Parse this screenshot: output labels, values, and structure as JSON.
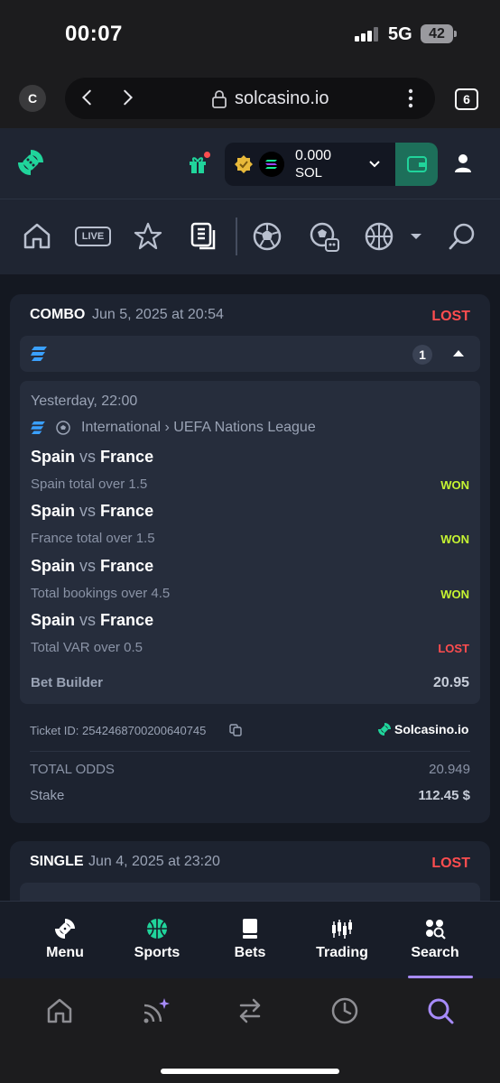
{
  "status_bar": {
    "time": "00:07",
    "network": "5G",
    "battery": "42"
  },
  "browser": {
    "avatar_letter": "C",
    "url": "solcasino.io",
    "tab_count": "6"
  },
  "header": {
    "balance_amount": "0.000",
    "balance_currency": "SOL",
    "colors": {
      "accent": "#20d49b",
      "background": "#1f2532"
    }
  },
  "sport_nav": {
    "live_label": "LIVE"
  },
  "bets": [
    {
      "type": "COMBO",
      "date": "Jun 5, 2025 at 20:54",
      "status": "LOST",
      "selection_count": "1",
      "event_time": "Yesterday, 22:00",
      "league_path": "International › UEFA Nations League",
      "legs": [
        {
          "home": "Spain",
          "vs": "vs",
          "away": "France",
          "market": "Spain total over 1.5",
          "result": "WON"
        },
        {
          "home": "Spain",
          "vs": "vs",
          "away": "France",
          "market": "France total over 1.5",
          "result": "WON"
        },
        {
          "home": "Spain",
          "vs": "vs",
          "away": "France",
          "market": "Total bookings over 4.5",
          "result": "WON"
        },
        {
          "home": "Spain",
          "vs": "vs",
          "away": "France",
          "market": "Total VAR over 0.5",
          "result": "LOST"
        }
      ],
      "bet_builder_label": "Bet Builder",
      "bet_builder_odds": "20.95",
      "ticket_id": "Ticket ID: 2542468700200640745",
      "brand": "Solcasino.io",
      "total_odds_label": "TOTAL ODDS",
      "total_odds": "20.949",
      "stake_label": "Stake",
      "stake": "112.45 $"
    },
    {
      "type": "SINGLE",
      "date": "Jun 4, 2025 at 23:20",
      "status": "LOST"
    }
  ],
  "app_tabs": [
    {
      "label": "Menu",
      "icon": "menu-logo-icon"
    },
    {
      "label": "Sports",
      "icon": "basketball-icon"
    },
    {
      "label": "Bets",
      "icon": "betslip-icon"
    },
    {
      "label": "Trading",
      "icon": "candlestick-icon"
    },
    {
      "label": "Search",
      "icon": "search-icon"
    }
  ]
}
